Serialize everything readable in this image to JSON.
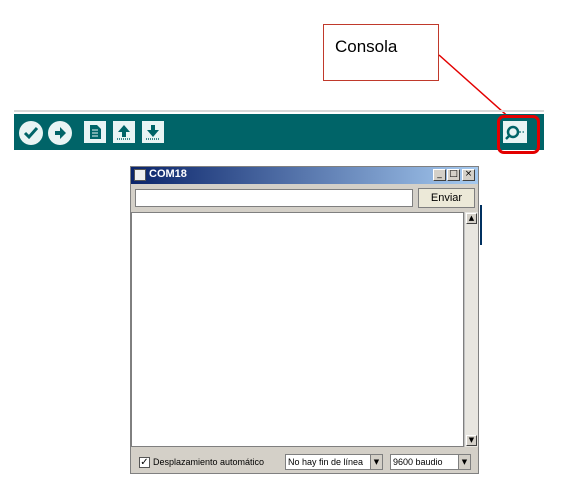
{
  "callout": {
    "label": "Consola",
    "line_color": "#e30000"
  },
  "toolbar": {
    "background": "#006468",
    "buttons": [
      {
        "name": "verify",
        "icon": "check-icon"
      },
      {
        "name": "upload",
        "icon": "arrow-right-icon"
      },
      {
        "name": "new",
        "icon": "document-icon"
      },
      {
        "name": "open",
        "icon": "arrow-up-icon"
      },
      {
        "name": "save",
        "icon": "arrow-down-icon"
      },
      {
        "name": "serial-monitor",
        "icon": "magnifier-icon"
      }
    ]
  },
  "serial_monitor": {
    "title": "COM18",
    "controls": {
      "minimize": "_",
      "maximize": "□",
      "close": "×"
    },
    "input_value": "",
    "send_label": "Enviar",
    "autoscroll_label": "Desplazamiento automático",
    "autoscroll_checked": true,
    "autoscroll_mark": "✓",
    "line_ending": "No hay fin de línea",
    "baud_rate": "9600 baudio",
    "arrows": {
      "up": "▲",
      "down": "▼"
    }
  }
}
